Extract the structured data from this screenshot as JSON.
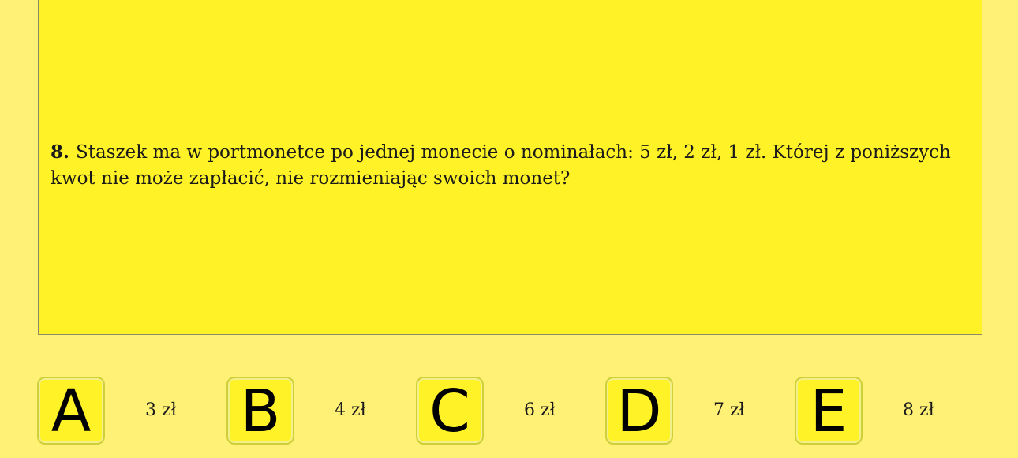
{
  "question": {
    "number": "8.",
    "text": "Staszek ma w portmonetce po jednej monecie o nominałach: 5 zł, 2 zł, 1 zł. Której z poniższych kwot nie może zapłacić, nie rozmieniając swoich monet?"
  },
  "answers": [
    {
      "letter": "A",
      "value": "3 zł"
    },
    {
      "letter": "B",
      "value": "4 zł"
    },
    {
      "letter": "C",
      "value": "6 zł"
    },
    {
      "letter": "D",
      "value": "7 zł"
    },
    {
      "letter": "E",
      "value": "8 zł"
    }
  ],
  "colors": {
    "background": "#fff176",
    "panel": "#fff226",
    "text": "#1a1a1a"
  }
}
